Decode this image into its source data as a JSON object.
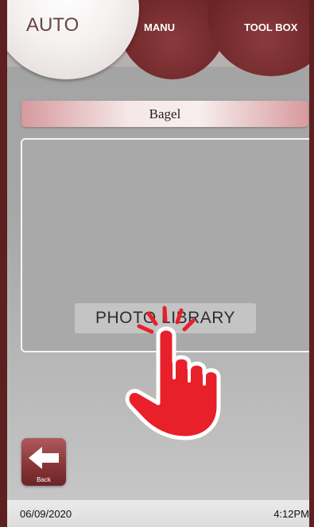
{
  "tabs": {
    "auto": "AUTO",
    "manu": "MANU",
    "toolbox": "TOOL BOX",
    "active": "auto"
  },
  "recipe": {
    "name": "Bagel"
  },
  "photo": {
    "button_label": "PHOTO LIBRARY"
  },
  "back": {
    "label": "Back",
    "icon": "arrow-left-icon"
  },
  "status": {
    "date": "06/09/2020",
    "time": "4:12PM"
  },
  "overlay": {
    "icon": "tap-hand-icon"
  },
  "colors": {
    "frame": "#5e1f20",
    "tab_inactive": "#6a2426",
    "hand_red": "#e8202a",
    "name_bar_edge": "#d79a9d"
  }
}
